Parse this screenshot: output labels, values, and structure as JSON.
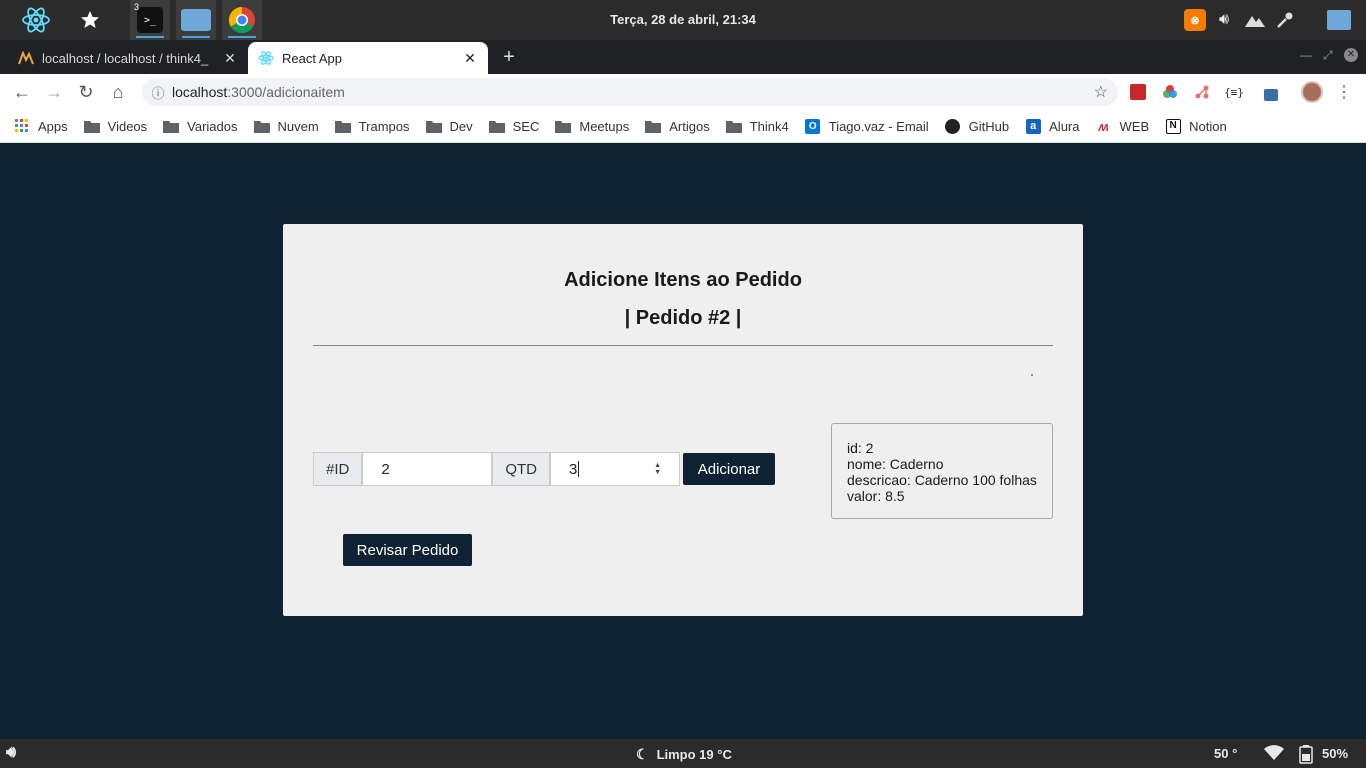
{
  "os": {
    "clock": "Terça, 28 de abril, 21:34",
    "terminal_badge": "3",
    "weather": "Limpo 19 °C",
    "temperature": "50 °",
    "battery": "50%"
  },
  "browser": {
    "tabs": [
      {
        "title": "localhost / localhost / think4_",
        "active": false
      },
      {
        "title": "React App",
        "active": true
      }
    ],
    "address": {
      "host": "localhost",
      "path": ":3000/adicionaitem"
    },
    "bookmarks": [
      {
        "label": "Apps",
        "icon": "apps-grid-icon"
      },
      {
        "label": "Videos",
        "icon": "folder-icon"
      },
      {
        "label": "Variados",
        "icon": "folder-icon"
      },
      {
        "label": "Nuvem",
        "icon": "folder-icon"
      },
      {
        "label": "Trampos",
        "icon": "folder-icon"
      },
      {
        "label": "Dev",
        "icon": "folder-icon"
      },
      {
        "label": "SEC",
        "icon": "folder-icon"
      },
      {
        "label": "Meetups",
        "icon": "folder-icon"
      },
      {
        "label": "Artigos",
        "icon": "folder-icon"
      },
      {
        "label": "Think4",
        "icon": "folder-icon"
      },
      {
        "label": "Tiago.vaz - Email",
        "icon": "outlook-icon"
      },
      {
        "label": "GitHub",
        "icon": "github-icon"
      },
      {
        "label": "Alura",
        "icon": "alura-icon"
      },
      {
        "label": "WEB",
        "icon": "web-icon"
      },
      {
        "label": "Notion",
        "icon": "notion-icon"
      }
    ]
  },
  "app": {
    "title": "Adicione Itens ao Pedido",
    "subtitle": "| Pedido #2 |",
    "form": {
      "id_label": "#ID",
      "id_value": "2",
      "qtd_label": "QTD",
      "qtd_value": "3",
      "add_button": "Adicionar"
    },
    "review_button": "Revisar Pedido",
    "item": {
      "id": "id: 2",
      "nome": "nome: Caderno",
      "descricao": "descricao: Caderno 100 folhas",
      "valor": "valor: 8.5"
    }
  },
  "colors": {
    "page_bg": "#0f2233",
    "card_bg": "#efefef",
    "button_bg": "#0f2233"
  }
}
